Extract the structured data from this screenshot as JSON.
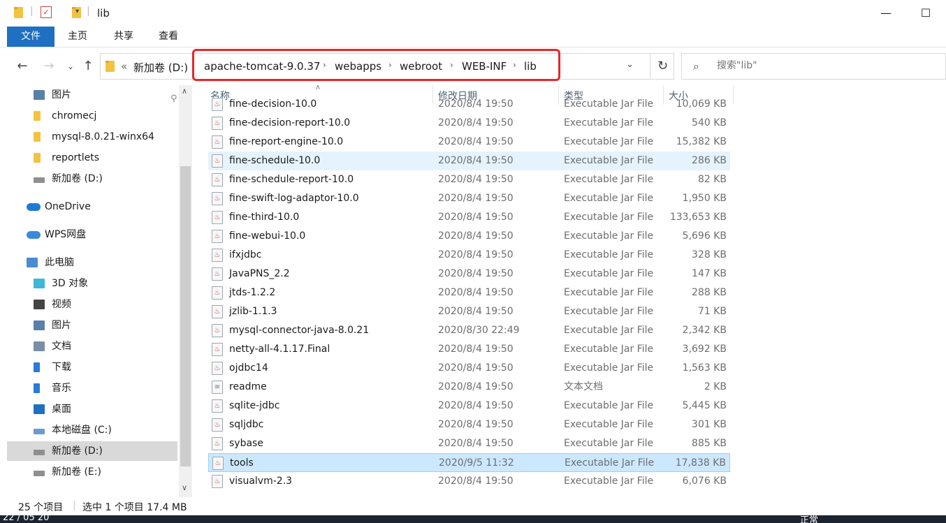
{
  "window": {
    "title": "lib",
    "minimize_glyph": "—",
    "maximize_glyph": "☐"
  },
  "ribbon": {
    "tabs": [
      "文件",
      "主页",
      "共享",
      "查看"
    ]
  },
  "address": {
    "crumbs": [
      "新加卷 (D:)",
      "apache-tomcat-9.0.37",
      "webapps",
      "webroot",
      "WEB-INF",
      "lib"
    ],
    "overflow": "«",
    "search_placeholder": "搜索\"lib\""
  },
  "sidebar": {
    "items": [
      {
        "label": "图片",
        "icon": "pictures-icon",
        "color": "#5a7fa8"
      },
      {
        "label": "chromecj",
        "icon": "folder-icon",
        "color": "#f3c241"
      },
      {
        "label": "mysql-8.0.21-winx64",
        "icon": "folder-icon",
        "color": "#f3c241"
      },
      {
        "label": "reportlets",
        "icon": "folder-icon",
        "color": "#f3c241"
      },
      {
        "label": "新加卷 (D:)",
        "icon": "drive-icon",
        "color": "#8f8f8f"
      },
      {
        "label": "OneDrive",
        "icon": "onedrive-icon",
        "color": "#1e7ad6"
      },
      {
        "label": "WPS网盘",
        "icon": "cloud-icon",
        "color": "#3b8ad9"
      },
      {
        "label": "此电脑",
        "icon": "computer-icon",
        "color": "#4b8bd0"
      },
      {
        "label": "3D 对象",
        "icon": "3d-objects-icon",
        "color": "#3fb6d7"
      },
      {
        "label": "视频",
        "icon": "video-icon",
        "color": "#444444"
      },
      {
        "label": "图片",
        "icon": "pictures-icon",
        "color": "#5a7fa8"
      },
      {
        "label": "文档",
        "icon": "documents-icon",
        "color": "#7a8ea6"
      },
      {
        "label": "下载",
        "icon": "download-icon",
        "color": "#2a7ad6"
      },
      {
        "label": "音乐",
        "icon": "music-icon",
        "color": "#2a7ad6"
      },
      {
        "label": "桌面",
        "icon": "desktop-icon",
        "color": "#1f6fc2"
      },
      {
        "label": "本地磁盘 (C:)",
        "icon": "windows-drive-icon",
        "color": "#6b9bd1"
      },
      {
        "label": "新加卷 (D:)",
        "icon": "drive-icon",
        "color": "#8f8f8f"
      },
      {
        "label": "新加卷 (E:)",
        "icon": "drive-icon",
        "color": "#8f8f8f"
      }
    ]
  },
  "columns": {
    "name": "名称",
    "date": "修改日期",
    "type": "类型",
    "size": "大小"
  },
  "files": [
    {
      "name": "fine-decision-10.0",
      "date": "2020/8/4 19:50",
      "type": "Executable Jar File",
      "size": "10,069 KB"
    },
    {
      "name": "fine-decision-report-10.0",
      "date": "2020/8/4 19:50",
      "type": "Executable Jar File",
      "size": "540 KB"
    },
    {
      "name": "fine-report-engine-10.0",
      "date": "2020/8/4 19:50",
      "type": "Executable Jar File",
      "size": "15,382 KB"
    },
    {
      "name": "fine-schedule-10.0",
      "date": "2020/8/4 19:50",
      "type": "Executable Jar File",
      "size": "286 KB"
    },
    {
      "name": "fine-schedule-report-10.0",
      "date": "2020/8/4 19:50",
      "type": "Executable Jar File",
      "size": "82 KB"
    },
    {
      "name": "fine-swift-log-adaptor-10.0",
      "date": "2020/8/4 19:50",
      "type": "Executable Jar File",
      "size": "1,950 KB"
    },
    {
      "name": "fine-third-10.0",
      "date": "2020/8/4 19:50",
      "type": "Executable Jar File",
      "size": "133,653 KB"
    },
    {
      "name": "fine-webui-10.0",
      "date": "2020/8/4 19:50",
      "type": "Executable Jar File",
      "size": "5,696 KB"
    },
    {
      "name": "ifxjdbc",
      "date": "2020/8/4 19:50",
      "type": "Executable Jar File",
      "size": "328 KB"
    },
    {
      "name": "JavaPNS_2.2",
      "date": "2020/8/4 19:50",
      "type": "Executable Jar File",
      "size": "147 KB"
    },
    {
      "name": "jtds-1.2.2",
      "date": "2020/8/4 19:50",
      "type": "Executable Jar File",
      "size": "288 KB"
    },
    {
      "name": "jzlib-1.1.3",
      "date": "2020/8/4 19:50",
      "type": "Executable Jar File",
      "size": "71 KB"
    },
    {
      "name": "mysql-connector-java-8.0.21",
      "date": "2020/8/30 22:49",
      "type": "Executable Jar File",
      "size": "2,342 KB"
    },
    {
      "name": "netty-all-4.1.17.Final",
      "date": "2020/8/4 19:50",
      "type": "Executable Jar File",
      "size": "3,692 KB"
    },
    {
      "name": "ojdbc14",
      "date": "2020/8/4 19:50",
      "type": "Executable Jar File",
      "size": "1,563 KB"
    },
    {
      "name": "readme",
      "date": "2020/8/4 19:50",
      "type": "文本文档",
      "size": "2 KB"
    },
    {
      "name": "sqlite-jdbc",
      "date": "2020/8/4 19:50",
      "type": "Executable Jar File",
      "size": "5,445 KB"
    },
    {
      "name": "sqljdbc",
      "date": "2020/8/4 19:50",
      "type": "Executable Jar File",
      "size": "301 KB"
    },
    {
      "name": "sybase",
      "date": "2020/8/4 19:50",
      "type": "Executable Jar File",
      "size": "885 KB"
    },
    {
      "name": "tools",
      "date": "2020/9/5 11:32",
      "type": "Executable Jar File",
      "size": "17,838 KB"
    },
    {
      "name": "visualvm-2.3",
      "date": "2020/8/4 19:50",
      "type": "Executable Jar File",
      "size": "6,076 KB"
    }
  ],
  "status": {
    "count": "25 个项目",
    "selected": "选中 1 个项目 17.4 MB"
  },
  "taskbar": {
    "left_text": "22 / 05 20",
    "right_text": "正常"
  },
  "colors": {
    "accent": "#1f6fc2",
    "highlight_box": "#e8262a",
    "selection": "#cce8ff"
  }
}
